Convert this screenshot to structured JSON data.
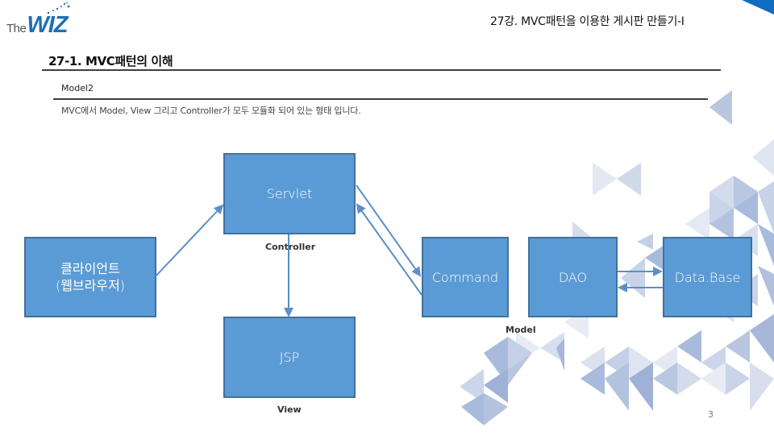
{
  "header": {
    "logo_prefix": "The",
    "logo_brand": "WIZ",
    "lecture_title": "27강. MVC패턴을 이용한 게시판 만들기-I"
  },
  "section": {
    "title": "27-1. MVC패턴의 이해",
    "subheading": "Model2",
    "description": "MVC에서 Model, View 그리고 Controller가 모두 모듈화 되어 있는 형태 입니다."
  },
  "diagram": {
    "nodes": {
      "client": {
        "line1": "클라이언트",
        "line2": "(웹브라우저)"
      },
      "servlet": "Servlet",
      "command": "Command",
      "dao": "DAO",
      "database": "Data.Base",
      "jsp": "JSP"
    },
    "group_labels": {
      "controller": "Controller",
      "model": "Model",
      "view": "View"
    },
    "edges": [
      {
        "from": "client",
        "to": "servlet"
      },
      {
        "from": "servlet",
        "to": "command"
      },
      {
        "from": "command",
        "to": "servlet"
      },
      {
        "from": "servlet",
        "to": "jsp"
      },
      {
        "from": "dao",
        "to": "database"
      },
      {
        "from": "database",
        "to": "dao"
      }
    ],
    "colors": {
      "box_fill": "#5b9bd5",
      "box_border": "#41719c",
      "arrow": "#5b8fc9"
    }
  },
  "footer": {
    "page_number": "3"
  },
  "theme": {
    "brand_blue": "#1f6fb5",
    "pattern_light": "#dfe5f0",
    "pattern_mid": "#b8c6df",
    "pattern_dark": "#9fb2d6"
  }
}
